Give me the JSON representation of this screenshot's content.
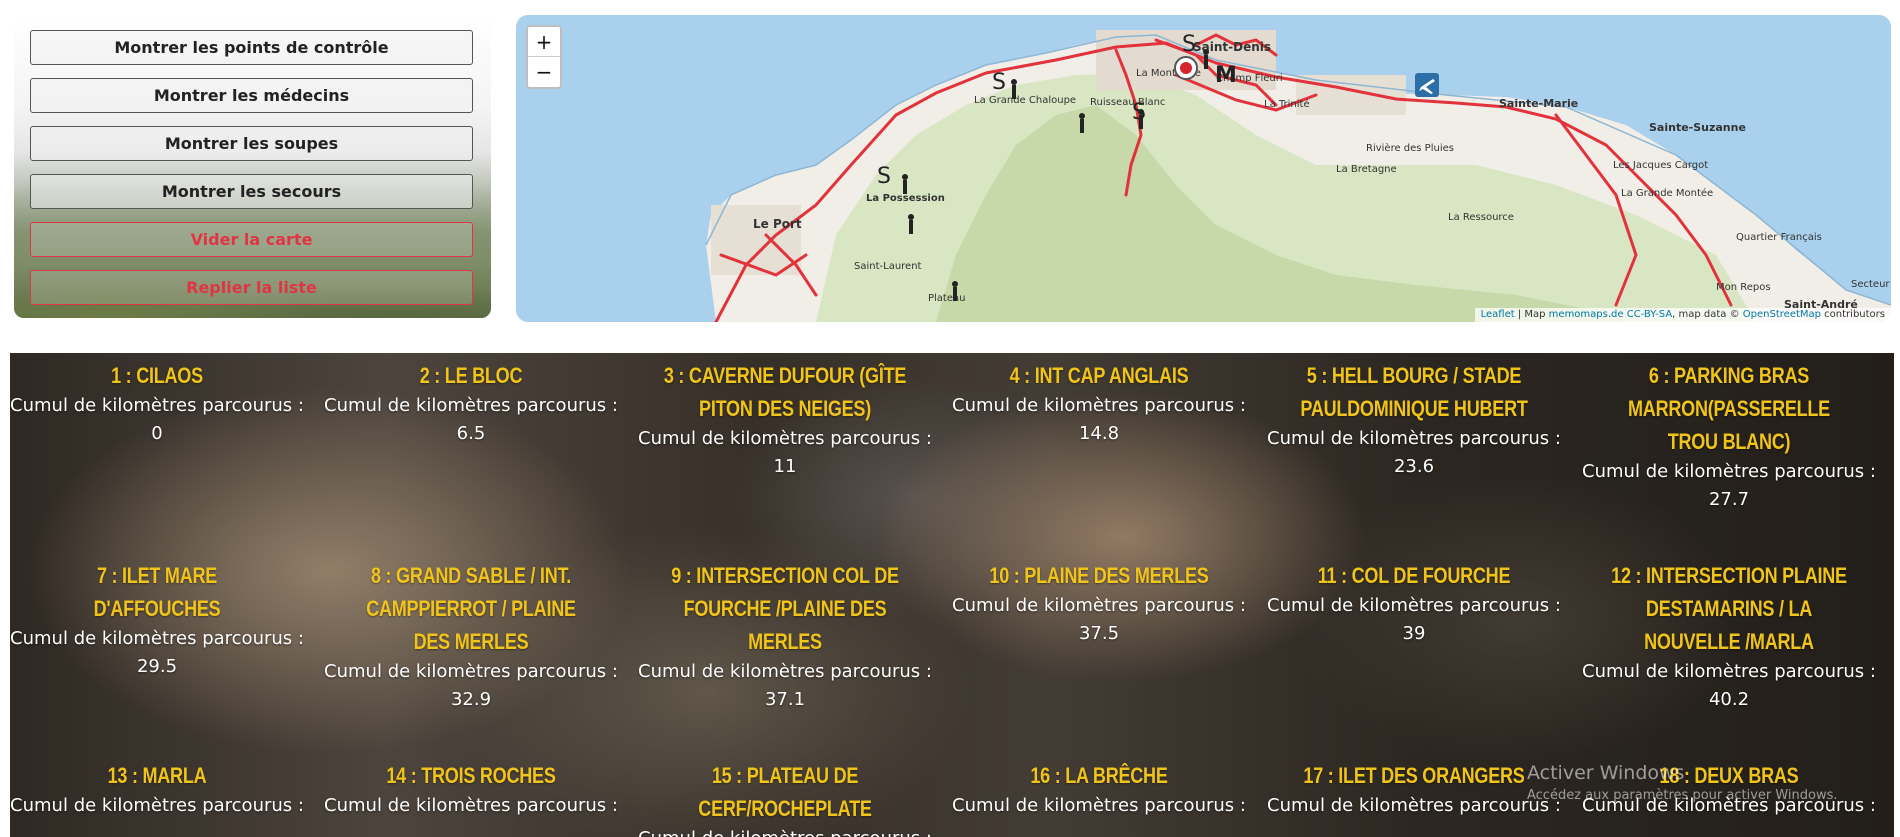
{
  "panel": {
    "buttons": [
      {
        "label": "Montrer les points de contrôle",
        "style": "normal"
      },
      {
        "label": "Montrer les médecins",
        "style": "normal"
      },
      {
        "label": "Montrer les soupes",
        "style": "normal"
      },
      {
        "label": "Montrer les secours",
        "style": "normal"
      },
      {
        "label": "Vider la carte",
        "style": "red"
      },
      {
        "label": "Replier la liste",
        "style": "red"
      }
    ]
  },
  "map": {
    "zoom_in": "+",
    "zoom_out": "−",
    "places": [
      "Saint-Denis",
      "La Montagne",
      "Champ Fleuri",
      "La Trinité",
      "Sainte-Marie",
      "Sainte-Suzanne",
      "La Grande Chaloupe",
      "Ruisseau Blanc",
      "Rivière des Pluies",
      "La Bretagne",
      "Les Jacques Cargot",
      "La Grande Montée",
      "La Ressource",
      "Quartier Français",
      "Mon Repos",
      "Secteur R",
      "Saint-André",
      "La Possession",
      "Le Port",
      "Saint-Laurent",
      "Plateau"
    ],
    "marker_letters": [
      "S",
      "S",
      "S",
      "S",
      "M"
    ],
    "attribution": {
      "leaflet": "Leaflet",
      "sep1": " | Map ",
      "memomaps": "memomaps.de",
      "cc": "CC-BY-SA",
      "sep2": ", map data © ",
      "osm": "OpenStreetMap",
      "contributors": " contributors"
    },
    "colors": {
      "sea": "#a9d0ec",
      "land": "#f1eee8",
      "route": "#e2323c"
    }
  },
  "checkpoints": {
    "label": "Cumul de kilomètres parcourus :",
    "items": [
      {
        "title": "1 : CILAOS",
        "km": "0"
      },
      {
        "title": "2 : LE BLOC",
        "km": "6.5"
      },
      {
        "title": "3 : CAVERNE DUFOUR (GÎTE PITON DES NEIGES)",
        "km": "11"
      },
      {
        "title": "4 : INT CAP ANGLAIS",
        "km": "14.8"
      },
      {
        "title": "5 : HELL BOURG / STADE PAULDOMINIQUE HUBERT",
        "km": "23.6"
      },
      {
        "title": "6 : PARKING BRAS MARRON(PASSERELLE TROU BLANC)",
        "km": "27.7"
      },
      {
        "title": "7 : ILET MARE D'AFFOUCHES",
        "km": "29.5"
      },
      {
        "title": "8 : GRAND SABLE / INT. CAMPPIERROT / PLAINE DES MERLES",
        "km": "32.9"
      },
      {
        "title": "9 : INTERSECTION COL DE FOURCHE /PLAINE DES MERLES",
        "km": "37.1"
      },
      {
        "title": "10 : PLAINE DES MERLES",
        "km": "37.5"
      },
      {
        "title": "11 : COL DE FOURCHE",
        "km": "39"
      },
      {
        "title": "12 : INTERSECTION PLAINE DESTAMARINS / LA NOUVELLE /MARLA",
        "km": "40.2"
      },
      {
        "title": "13 : MARLA",
        "km": ""
      },
      {
        "title": "14 : TROIS ROCHES",
        "km": ""
      },
      {
        "title": "15 : PLATEAU DE CERF/ROCHEPLATE",
        "km": ""
      },
      {
        "title": "16 : LA BRÊCHE",
        "km": ""
      },
      {
        "title": "17 : ILET DES ORANGERS",
        "km": ""
      },
      {
        "title": "18 : DEUX BRAS",
        "km": ""
      }
    ],
    "title_color": "#f0c419"
  },
  "watermark": {
    "line1": "Activer Windows",
    "line2": "Accédez aux paramètres pour activer Windows."
  }
}
